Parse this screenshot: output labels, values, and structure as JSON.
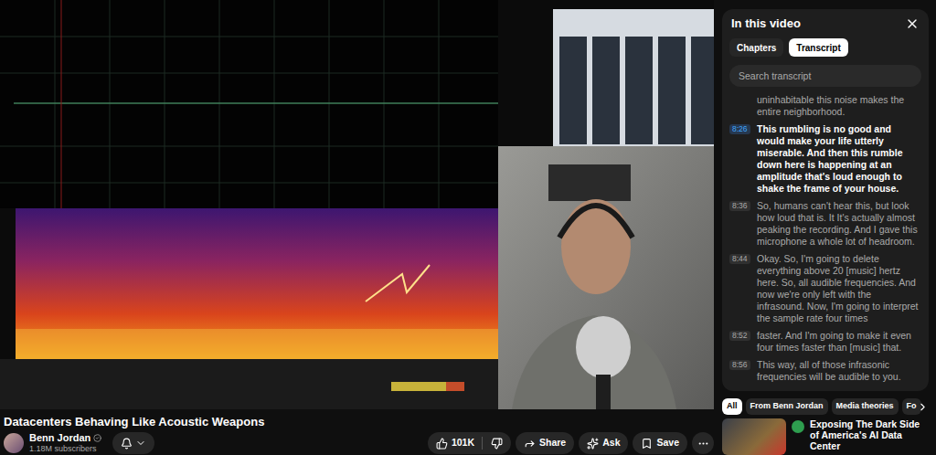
{
  "video": {
    "title": "Datacenters Behaving Like Acoustic Weapons"
  },
  "channel": {
    "name": "Benn Jordan",
    "verified": true,
    "subscribers": "1.18M subscribers"
  },
  "actions": {
    "likes": "101K",
    "buttons": [
      {
        "label": "Share",
        "kind": "share"
      },
      {
        "label": "Ask",
        "kind": "ask"
      },
      {
        "label": "Save",
        "kind": "save"
      }
    ]
  },
  "panel": {
    "title": "In this video",
    "tabs": [
      {
        "label": "Chapters",
        "selected": false
      },
      {
        "label": "Transcript",
        "selected": true
      }
    ],
    "search": {
      "placeholder": "Search transcript"
    },
    "segments": [
      {
        "text": "uninhabitable this noise makes the entire neighborhood.",
        "selected": false
      },
      {
        "time": "8:26",
        "text": "This rumbling is no good and would make your life utterly miserable. And then this rumble down here is happening at an amplitude that's loud enough to shake the frame of your house.",
        "selected": true
      },
      {
        "time": "8:36",
        "text": "So, humans can't hear this, but look how loud that is. It It's actually almost peaking the recording. And I gave this microphone a whole lot of headroom.",
        "selected": false
      },
      {
        "time": "8:44",
        "text": "Okay. So, I'm going to delete everything above 20 [music] hertz here. So, all audible frequencies. And now we're only left with the infrasound. Now, I'm going to interpret the sample rate four times",
        "selected": false
      },
      {
        "time": "8:52",
        "text": "faster. And I'm going to make it even four times faster than [music] that.",
        "selected": false
      },
      {
        "time": "8:56",
        "text": "This way, all of those infrasonic frequencies will be audible to you.",
        "selected": false
      }
    ]
  },
  "chips": [
    {
      "label": "All",
      "selected": true
    },
    {
      "label": "From Benn Jordan",
      "selected": false
    },
    {
      "label": "Media theories",
      "selected": false
    },
    {
      "label": "Fo",
      "selected": false
    }
  ],
  "recommendation": {
    "title": "Exposing The Dark Side of America's AI Data Center"
  }
}
